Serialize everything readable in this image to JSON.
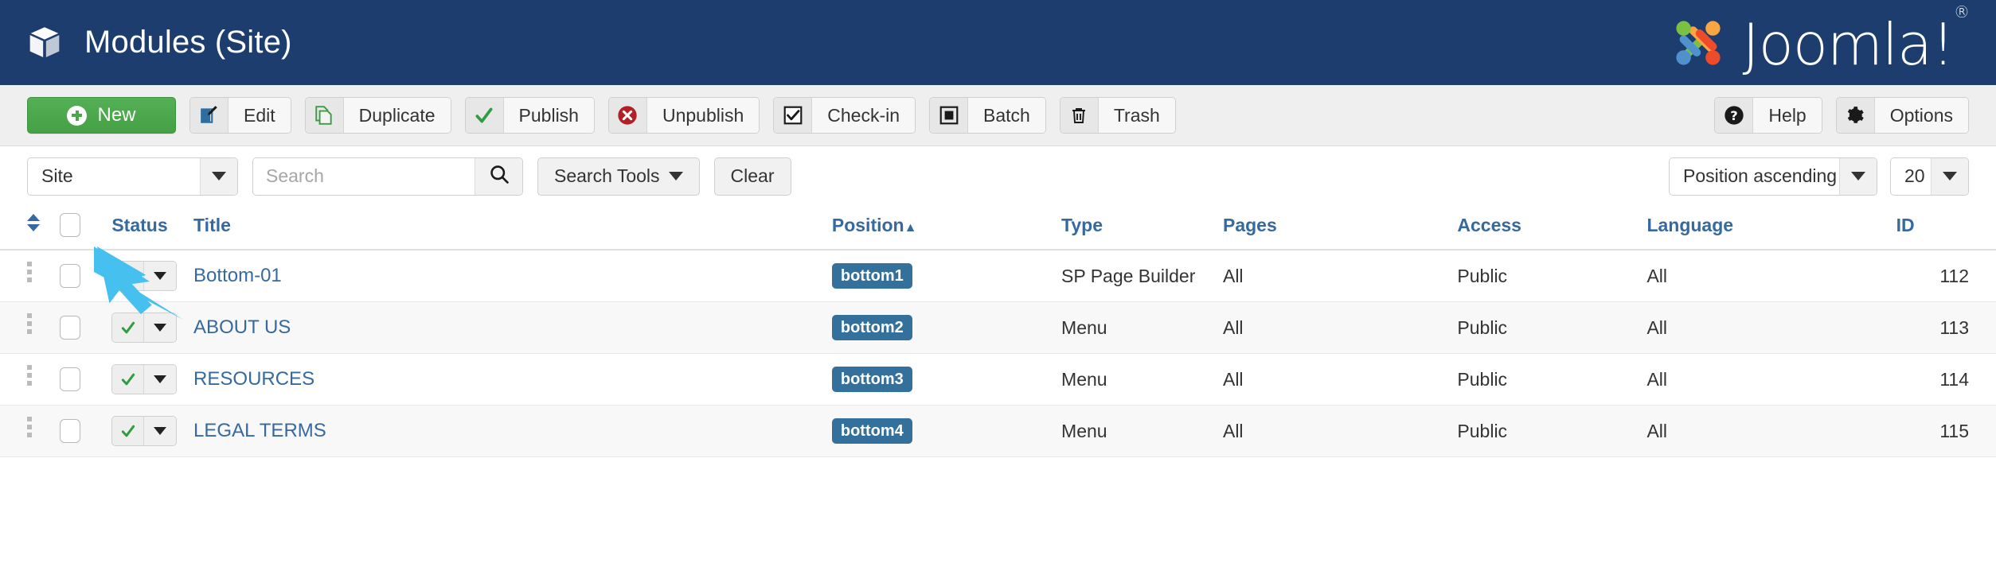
{
  "header": {
    "title": "Modules (Site)",
    "icon": "cube-icon",
    "brand": "Joomla!",
    "brand_trademark": "®",
    "bg_color": "#1c3d6e"
  },
  "toolbar": {
    "new_label": "New",
    "new_color": "#4ca64c",
    "buttons": [
      {
        "label": "Edit",
        "icon": "pencil-square-icon"
      },
      {
        "label": "Duplicate",
        "icon": "copy-icon"
      },
      {
        "label": "Publish",
        "icon": "check-icon"
      },
      {
        "label": "Unpublish",
        "icon": "circle-x-icon"
      },
      {
        "label": "Check-in",
        "icon": "checkbox-icon"
      },
      {
        "label": "Batch",
        "icon": "square-filled-icon"
      },
      {
        "label": "Trash",
        "icon": "trash-icon"
      }
    ],
    "right_buttons": [
      {
        "label": "Help",
        "icon": "question-circle-icon"
      },
      {
        "label": "Options",
        "icon": "gear-icon"
      }
    ]
  },
  "filters": {
    "site_select": "Site",
    "search_placeholder": "Search",
    "search_value": "",
    "search_icon": "magnifier-icon",
    "search_tools_label": "Search Tools",
    "clear_label": "Clear",
    "ordering_select": "Position ascending",
    "limit_select": "20"
  },
  "table": {
    "columns": [
      {
        "key": "ordering",
        "label": "",
        "sort_icon": "sort-updown-icon"
      },
      {
        "key": "checkall",
        "label": ""
      },
      {
        "key": "status",
        "label": "Status"
      },
      {
        "key": "title",
        "label": "Title"
      },
      {
        "key": "position",
        "label": "Position",
        "sorted": "asc"
      },
      {
        "key": "type",
        "label": "Type"
      },
      {
        "key": "pages",
        "label": "Pages"
      },
      {
        "key": "access",
        "label": "Access"
      },
      {
        "key": "language",
        "label": "Language"
      },
      {
        "key": "id",
        "label": "ID"
      }
    ],
    "rows": [
      {
        "title": "Bottom-01",
        "position": "bottom1",
        "type": "SP Page Builder",
        "pages": "All",
        "access": "Public",
        "language": "All",
        "id": "112",
        "status": "published"
      },
      {
        "title": "ABOUT US",
        "position": "bottom2",
        "type": "Menu",
        "pages": "All",
        "access": "Public",
        "language": "All",
        "id": "113",
        "status": "published"
      },
      {
        "title": "RESOURCES",
        "position": "bottom3",
        "type": "Menu",
        "pages": "All",
        "access": "Public",
        "language": "All",
        "id": "114",
        "status": "published"
      },
      {
        "title": "LEGAL TERMS",
        "position": "bottom4",
        "type": "Menu",
        "pages": "All",
        "access": "Public",
        "language": "All",
        "id": "115",
        "status": "published"
      }
    ],
    "badge_color": "#33709c",
    "link_color": "#36699e"
  },
  "annotation": {
    "cursor_color": "#45c0ef",
    "points_at": "New"
  }
}
